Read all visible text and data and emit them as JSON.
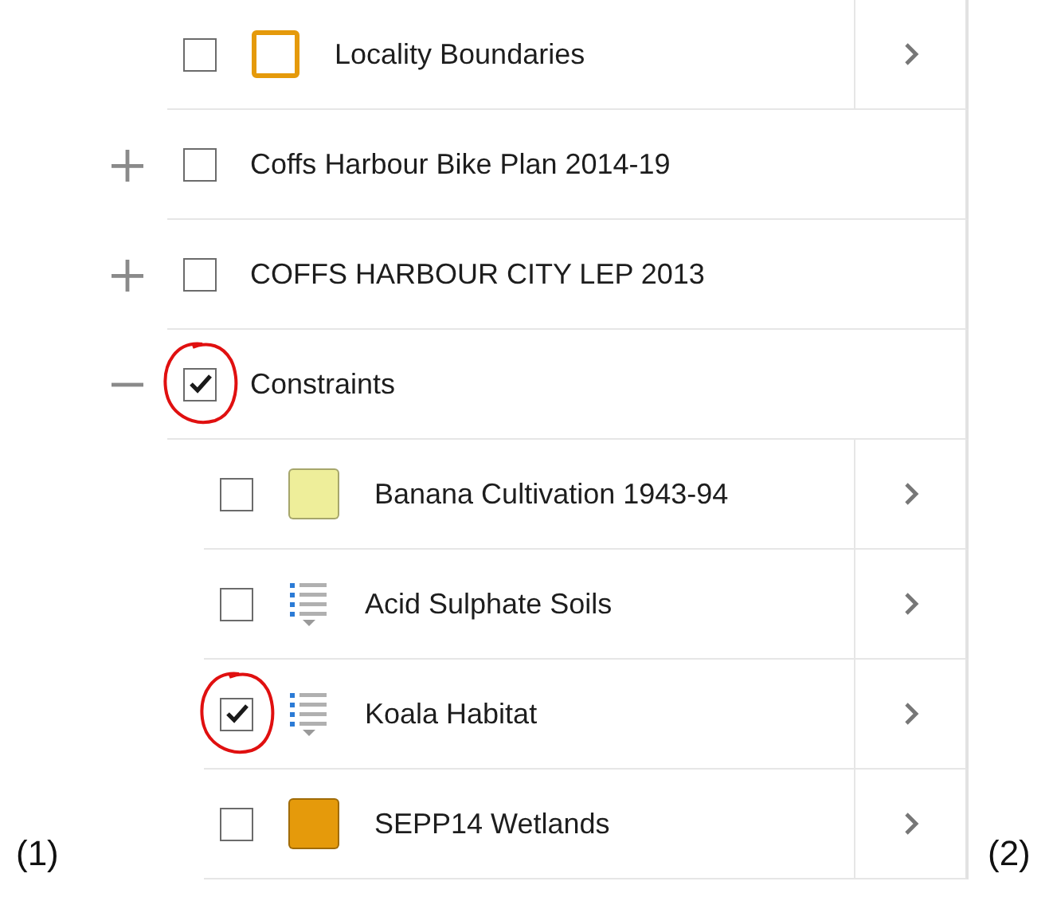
{
  "layers": [
    {
      "kind": "layer",
      "label": "Locality Boundaries",
      "checked": false,
      "legend": {
        "kind": "outline",
        "color": "#e59a0b"
      }
    },
    {
      "kind": "group",
      "label": "Coffs Harbour Bike Plan 2014-19",
      "checked": false,
      "expanded": false
    },
    {
      "kind": "group",
      "label": "COFFS HARBOUR CITY LEP 2013",
      "checked": false,
      "expanded": false
    },
    {
      "kind": "group",
      "label": "Constraints",
      "checked": true,
      "circled": true,
      "expanded": true,
      "children": [
        {
          "kind": "layer",
          "label": "Banana Cultivation 1943-94",
          "checked": false,
          "legend": {
            "kind": "fill",
            "color": "#eeee9a"
          }
        },
        {
          "kind": "layer",
          "label": "Acid Sulphate Soils",
          "checked": false,
          "legend": {
            "kind": "list"
          }
        },
        {
          "kind": "layer",
          "label": "Koala Habitat",
          "checked": true,
          "circled": true,
          "legend": {
            "kind": "list"
          }
        },
        {
          "kind": "layer",
          "label": "SEPP14 Wetlands",
          "checked": false,
          "legend": {
            "kind": "fill",
            "color": "#e59a0b"
          }
        }
      ]
    }
  ],
  "figure_labels": [
    "(1)",
    "(2)"
  ]
}
